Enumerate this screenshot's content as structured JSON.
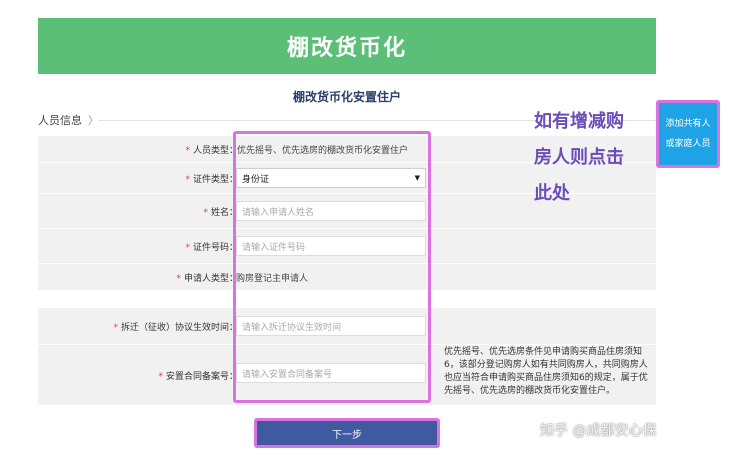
{
  "banner": {
    "title": "棚改货币化"
  },
  "page": {
    "subtitle": "棚改货币化安置住户"
  },
  "section": {
    "label": "人员信息",
    "arrow": "〉"
  },
  "form": {
    "required_mark": "*",
    "person_type": {
      "label": "人员类型：",
      "value": "优先摇号、优先选房的棚改货币化安置住户"
    },
    "id_type": {
      "label": "证件类型：",
      "value": "身份证"
    },
    "name": {
      "label": "姓名：",
      "placeholder": "请输入申请人姓名"
    },
    "id_number": {
      "label": "证件号码：",
      "placeholder": "请输入证件号码"
    },
    "applicant_type": {
      "label": "申请人类型：",
      "value": "购房登记主申请人"
    },
    "demolition_date": {
      "label": "拆迁（征收）协议生效时间：",
      "placeholder": "请输入拆迁协议生效时间"
    },
    "contract_no": {
      "label": "安置合同备案号：",
      "placeholder": "请输入安置合同备案号"
    },
    "note": "优先摇号、优先选房条件见申请购买商品住房须知6，该部分登记购房人如有共同购房人，共同购房人也应当符合申请购买商品住房须知6的规定，属于优先摇号、优先选房的棚改货币化安置住户。"
  },
  "buttons": {
    "next": "下一步",
    "add_line1": "添加共有人",
    "add_line2": "或家庭人员"
  },
  "callout": {
    "line1": "如有增减购",
    "line2": "房人则点击",
    "line3": "此处"
  },
  "watermark": "知乎 @成都安心保",
  "colors": {
    "banner": "#5cbf78",
    "accent_highlight": "#d873e0",
    "next_button": "#3f5aa0",
    "add_button": "#1ea4e6",
    "callout_text": "#6b4db8",
    "required": "#e23b3b"
  }
}
